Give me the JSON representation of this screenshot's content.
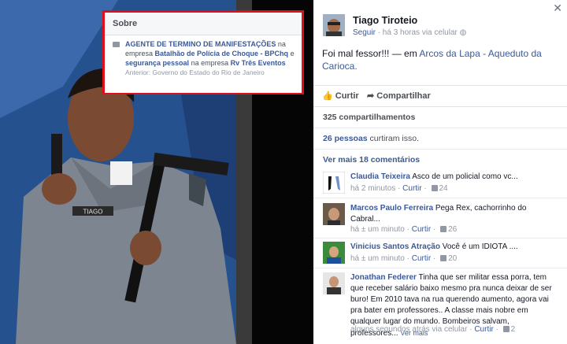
{
  "photo": {
    "name_tag": "TIAGO"
  },
  "overlay": {
    "header": "Sobre",
    "job_title": "AGENTE DE TERMINO DE MANIFESTAÇÕES",
    "text_na_empresa": "na empresa",
    "company1": "Batalhão de Polícia de Choque - BPChq",
    "text_e": "e",
    "job2": "segurança pessoal",
    "text_na_empresa2": "na empresa",
    "company2": "Rv Três Eventos",
    "previous": "Anterior: Governo do Estado do Rio de Janeiro"
  },
  "post": {
    "author": "Tiago Tiroteio",
    "follow": "Seguir",
    "time": "há 3 horas via celular",
    "status_text": "Foi mal fessor!!! — em",
    "location": "Arcos da Lapa - Aqueduto da Carioca.",
    "like_label": "Curtir",
    "share_label": "Compartilhar",
    "shares": "325 compartilhamentos",
    "likes": "26 pessoas curtiram isso.",
    "likes_people": "26 pessoas",
    "likes_rest": "curtiram isso.",
    "more_comments": "Ver mais 18 comentários"
  },
  "comments": [
    {
      "name": "Claudia Teixeira",
      "text": "Asco de um policial como vc...",
      "time": "há 2 minutos",
      "like": "Curtir",
      "count": "24"
    },
    {
      "name": "Marcos Paulo Ferreira",
      "text": "Pega Rex, cachorrinho do Cabral...",
      "time": "há ± um minuto",
      "like": "Curtir",
      "count": "26"
    },
    {
      "name": "Vinicius Santos Atração",
      "text": "Você é um IDIOTA ....",
      "time": "há ± um minuto",
      "like": "Curtir",
      "count": "20"
    },
    {
      "name": "Jonathan Federer",
      "text": "Tinha que ser militar essa porra, tem que receber salário baixo mesmo pra nunca deixar de ser buro! Em 2010 tava na rua querendo aumento, agora vai pra bater em professores.. A classe mais nobre em qualquer lugar do mundo. Bombeiros salvam, professores...",
      "more": "Ver mais",
      "time": "alguns segundos atrás via celular",
      "like": "Curtir",
      "count": "2"
    }
  ],
  "colors": {
    "link": "#3b5998",
    "highlight_border": "#e0101a",
    "muted": "#9197a3"
  }
}
